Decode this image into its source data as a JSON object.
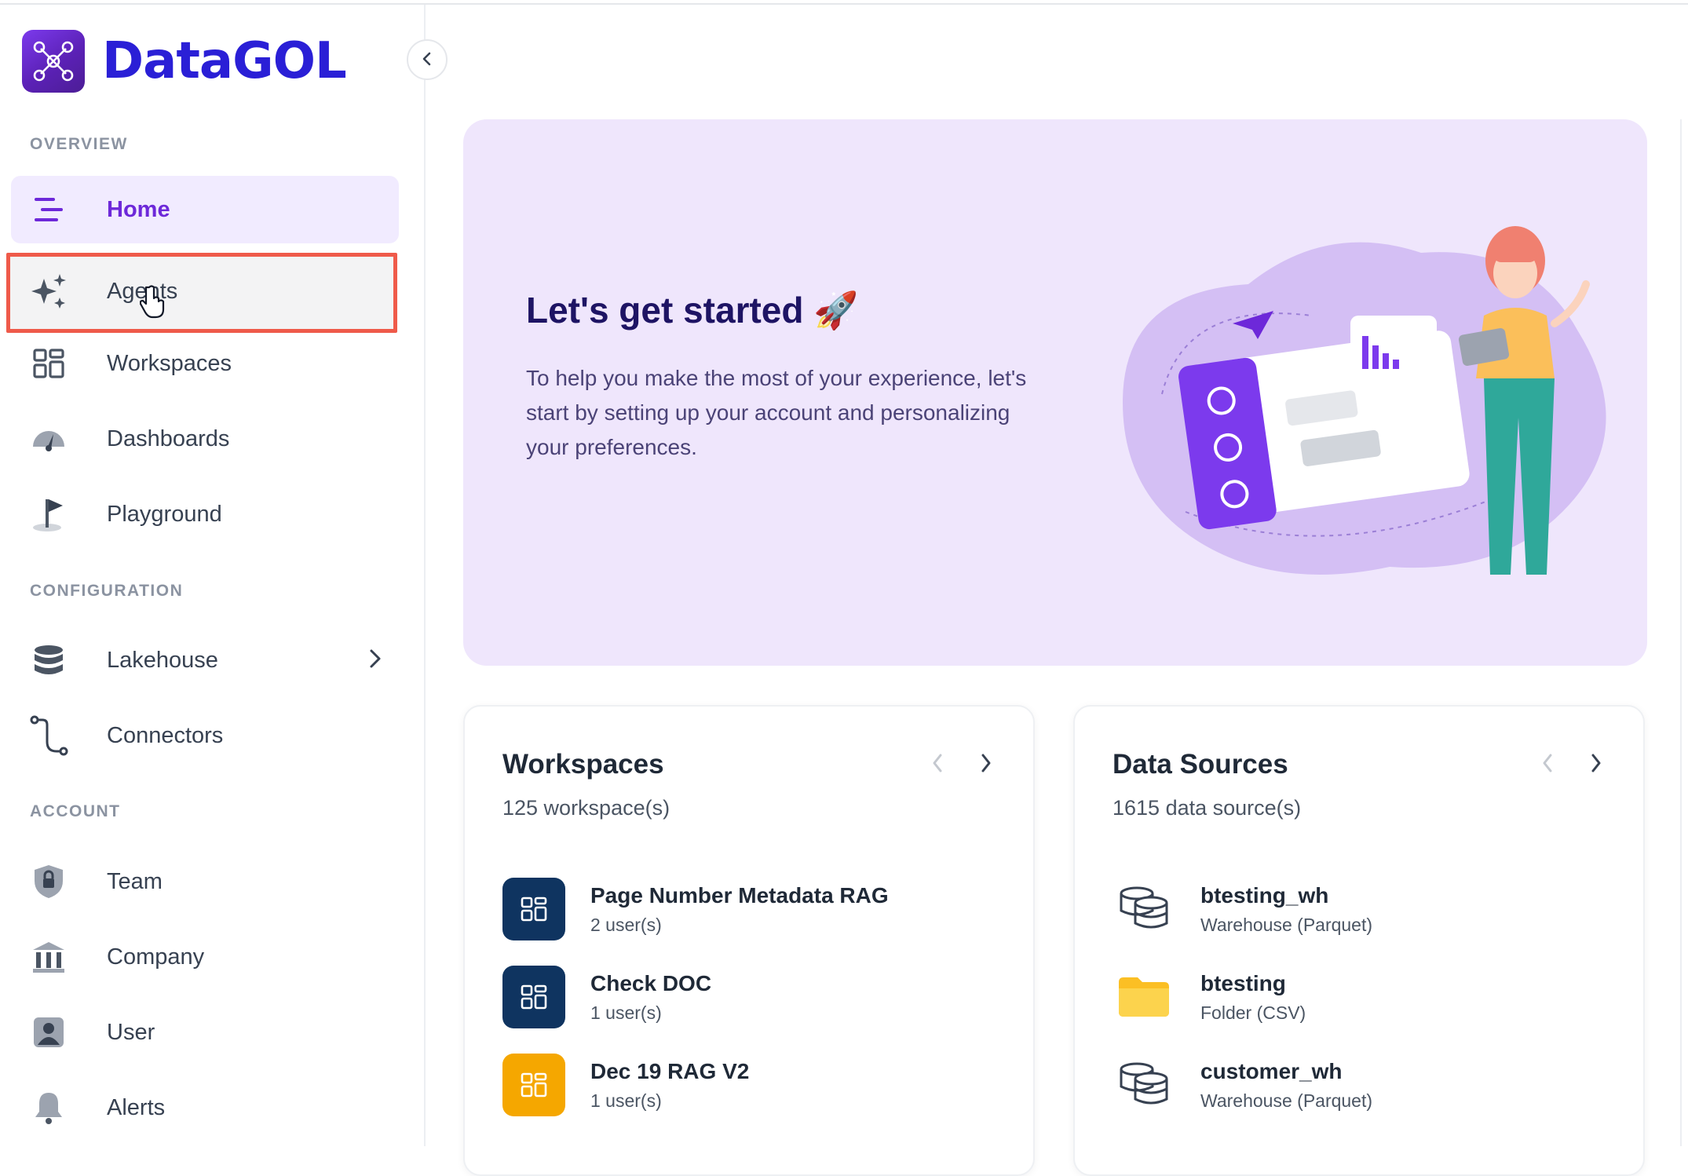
{
  "app": {
    "name": "DataGOL",
    "accent_color": "#6d28d9",
    "logo_color": "#2a1fd6"
  },
  "sidebar": {
    "sections": {
      "overview": "OVERVIEW",
      "configuration": "CONFIGURATION",
      "account": "ACCOUNT"
    },
    "items": [
      {
        "label": "Home",
        "icon": "home-lines-icon",
        "active": true
      },
      {
        "label": "Agents",
        "icon": "sparkles-icon",
        "highlighted": true
      },
      {
        "label": "Workspaces",
        "icon": "grid-icon"
      },
      {
        "label": "Dashboards",
        "icon": "gauge-icon"
      },
      {
        "label": "Playground",
        "icon": "flag-icon"
      },
      {
        "label": "Lakehouse",
        "icon": "database-icon",
        "has_submenu": true
      },
      {
        "label": "Connectors",
        "icon": "connector-icon"
      },
      {
        "label": "Team",
        "icon": "shield-lock-icon"
      },
      {
        "label": "Company",
        "icon": "bank-icon"
      },
      {
        "label": "User",
        "icon": "user-icon"
      },
      {
        "label": "Alerts",
        "icon": "bell-icon"
      }
    ]
  },
  "hero": {
    "title": "Let's get started 🚀",
    "description": "To help you make the most of your experience, let's start by setting up your account and personalizing your preferences."
  },
  "workspaces_card": {
    "title": "Workspaces",
    "count": "125 workspace(s)",
    "items": [
      {
        "name": "Page Number Metadata RAG",
        "meta": "2 user(s)",
        "color": "#0f3460"
      },
      {
        "name": "Check DOC",
        "meta": "1 user(s)",
        "color": "#0f3460"
      },
      {
        "name": "Dec 19 RAG V2",
        "meta": "1 user(s)",
        "color": "#f5a700"
      }
    ]
  },
  "datasources_card": {
    "title": "Data Sources",
    "count": "1615 data source(s)",
    "items": [
      {
        "name": "btesting_wh",
        "meta": "Warehouse (Parquet)",
        "icon": "warehouse-icon"
      },
      {
        "name": "btesting",
        "meta": "Folder (CSV)",
        "icon": "folder-icon"
      },
      {
        "name": "customer_wh",
        "meta": "Warehouse (Parquet)",
        "icon": "warehouse-icon"
      }
    ]
  }
}
